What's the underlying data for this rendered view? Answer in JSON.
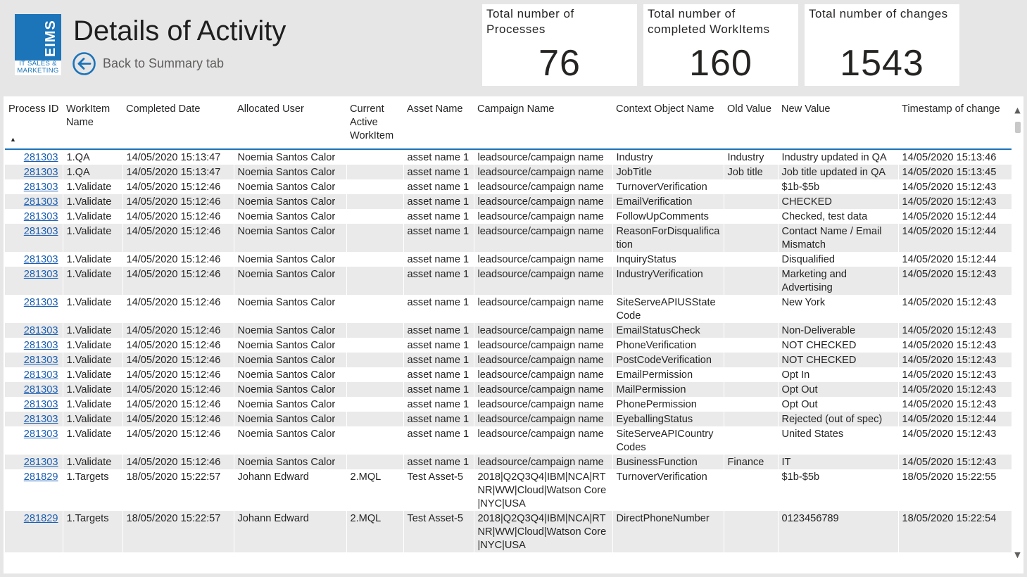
{
  "logo": {
    "letters": "EIMS",
    "tagline_1": "IT SALES &",
    "tagline_2": "MARKETING",
    "brand_color": "#1c74b9"
  },
  "header": {
    "title": "Details of Activity",
    "back_label": "Back to Summary tab"
  },
  "cards": [
    {
      "title": "Total number of Processes",
      "value": "76"
    },
    {
      "title": "Total number of completed WorkItems",
      "value": "160"
    },
    {
      "title": "Total number of changes",
      "value": "1543"
    }
  ],
  "table": {
    "columns": [
      "Process ID",
      "WorkItem Name",
      "Completed Date",
      "Allocated User",
      "Current Active WorkItem",
      "Asset Name",
      "Campaign Name",
      "Context Object Name",
      "Old Value",
      "New Value",
      "Timestamp of change"
    ],
    "sort": {
      "column": "Process ID",
      "direction": "ascending"
    },
    "rows": [
      [
        "281303",
        "1.QA",
        "14/05/2020 15:13:47",
        "Noemia Santos Calor",
        "",
        "asset name 1",
        "leadsource/campaign name",
        "Industry",
        "Industry",
        "Industry updated in QA",
        "14/05/2020 15:13:46"
      ],
      [
        "281303",
        "1.QA",
        "14/05/2020 15:13:47",
        "Noemia Santos Calor",
        "",
        "asset name 1",
        "leadsource/campaign name",
        "JobTitle",
        "Job title",
        "Job title updated in QA",
        "14/05/2020 15:13:45"
      ],
      [
        "281303",
        "1.Validate",
        "14/05/2020 15:12:46",
        "Noemia Santos Calor",
        "",
        "asset name 1",
        "leadsource/campaign name",
        "TurnoverVerification",
        "",
        "$1b-$5b",
        "14/05/2020 15:12:43"
      ],
      [
        "281303",
        "1.Validate",
        "14/05/2020 15:12:46",
        "Noemia Santos Calor",
        "",
        "asset name 1",
        "leadsource/campaign name",
        "EmailVerification",
        "",
        "CHECKED",
        "14/05/2020 15:12:43"
      ],
      [
        "281303",
        "1.Validate",
        "14/05/2020 15:12:46",
        "Noemia Santos Calor",
        "",
        "asset name 1",
        "leadsource/campaign name",
        "FollowUpComments",
        "",
        "Checked, test data",
        "14/05/2020 15:12:44"
      ],
      [
        "281303",
        "1.Validate",
        "14/05/2020 15:12:46",
        "Noemia Santos Calor",
        "",
        "asset name 1",
        "leadsource/campaign name",
        "ReasonForDisqualification",
        "",
        "Contact Name / Email Mismatch",
        "14/05/2020 15:12:44"
      ],
      [
        "281303",
        "1.Validate",
        "14/05/2020 15:12:46",
        "Noemia Santos Calor",
        "",
        "asset name 1",
        "leadsource/campaign name",
        "InquiryStatus",
        "",
        "Disqualified",
        "14/05/2020 15:12:44"
      ],
      [
        "281303",
        "1.Validate",
        "14/05/2020 15:12:46",
        "Noemia Santos Calor",
        "",
        "asset name 1",
        "leadsource/campaign name",
        "IndustryVerification",
        "",
        "Marketing and Advertising",
        "14/05/2020 15:12:43"
      ],
      [
        "281303",
        "1.Validate",
        "14/05/2020 15:12:46",
        "Noemia Santos Calor",
        "",
        "asset name 1",
        "leadsource/campaign name",
        "SiteServeAPIUSStateCode",
        "",
        "New York",
        "14/05/2020 15:12:43"
      ],
      [
        "281303",
        "1.Validate",
        "14/05/2020 15:12:46",
        "Noemia Santos Calor",
        "",
        "asset name 1",
        "leadsource/campaign name",
        "EmailStatusCheck",
        "",
        "Non-Deliverable",
        "14/05/2020 15:12:43"
      ],
      [
        "281303",
        "1.Validate",
        "14/05/2020 15:12:46",
        "Noemia Santos Calor",
        "",
        "asset name 1",
        "leadsource/campaign name",
        "PhoneVerification",
        "",
        "NOT CHECKED",
        "14/05/2020 15:12:43"
      ],
      [
        "281303",
        "1.Validate",
        "14/05/2020 15:12:46",
        "Noemia Santos Calor",
        "",
        "asset name 1",
        "leadsource/campaign name",
        "PostCodeVerification",
        "",
        "NOT CHECKED",
        "14/05/2020 15:12:43"
      ],
      [
        "281303",
        "1.Validate",
        "14/05/2020 15:12:46",
        "Noemia Santos Calor",
        "",
        "asset name 1",
        "leadsource/campaign name",
        "EmailPermission",
        "",
        "Opt In",
        "14/05/2020 15:12:43"
      ],
      [
        "281303",
        "1.Validate",
        "14/05/2020 15:12:46",
        "Noemia Santos Calor",
        "",
        "asset name 1",
        "leadsource/campaign name",
        "MailPermission",
        "",
        "Opt Out",
        "14/05/2020 15:12:43"
      ],
      [
        "281303",
        "1.Validate",
        "14/05/2020 15:12:46",
        "Noemia Santos Calor",
        "",
        "asset name 1",
        "leadsource/campaign name",
        "PhonePermission",
        "",
        "Opt Out",
        "14/05/2020 15:12:43"
      ],
      [
        "281303",
        "1.Validate",
        "14/05/2020 15:12:46",
        "Noemia Santos Calor",
        "",
        "asset name 1",
        "leadsource/campaign name",
        "EyeballingStatus",
        "",
        "Rejected (out of spec)",
        "14/05/2020 15:12:44"
      ],
      [
        "281303",
        "1.Validate",
        "14/05/2020 15:12:46",
        "Noemia Santos Calor",
        "",
        "asset name 1",
        "leadsource/campaign name",
        "SiteServeAPICountryCodes",
        "",
        "United States",
        "14/05/2020 15:12:43"
      ],
      [
        "281303",
        "1.Validate",
        "14/05/2020 15:12:46",
        "Noemia Santos Calor",
        "",
        "asset name 1",
        "leadsource/campaign name",
        "BusinessFunction",
        "Finance",
        "IT",
        "14/05/2020 15:12:43"
      ],
      [
        "281829",
        "1.Targets",
        "18/05/2020 15:22:57",
        "Johann Edward",
        "2.MQL",
        "Test Asset-5",
        "2018|Q2Q3Q4|IBM|NCA|RTNR|WW|Cloud|Watson Core|NYC|USA",
        "TurnoverVerification",
        "",
        "$1b-$5b",
        "18/05/2020 15:22:55"
      ],
      [
        "281829",
        "1.Targets",
        "18/05/2020 15:22:57",
        "Johann Edward",
        "2.MQL",
        "Test Asset-5",
        "2018|Q2Q3Q4|IBM|NCA|RTNR|WW|Cloud|Watson Core|NYC|USA",
        "DirectPhoneNumber",
        "",
        "0123456789",
        "18/05/2020 15:22:54"
      ]
    ]
  },
  "icons": {
    "back": "back-arrow-circle-icon",
    "scroll_up": "chevron-up-icon",
    "scroll_down": "chevron-down-icon",
    "sort": "sort-ascending-icon"
  },
  "colors": {
    "accent": "#1c74b9",
    "link": "#1c5fb3",
    "row_alt": "#eaeaea",
    "canvas": "#e6e6e6"
  }
}
